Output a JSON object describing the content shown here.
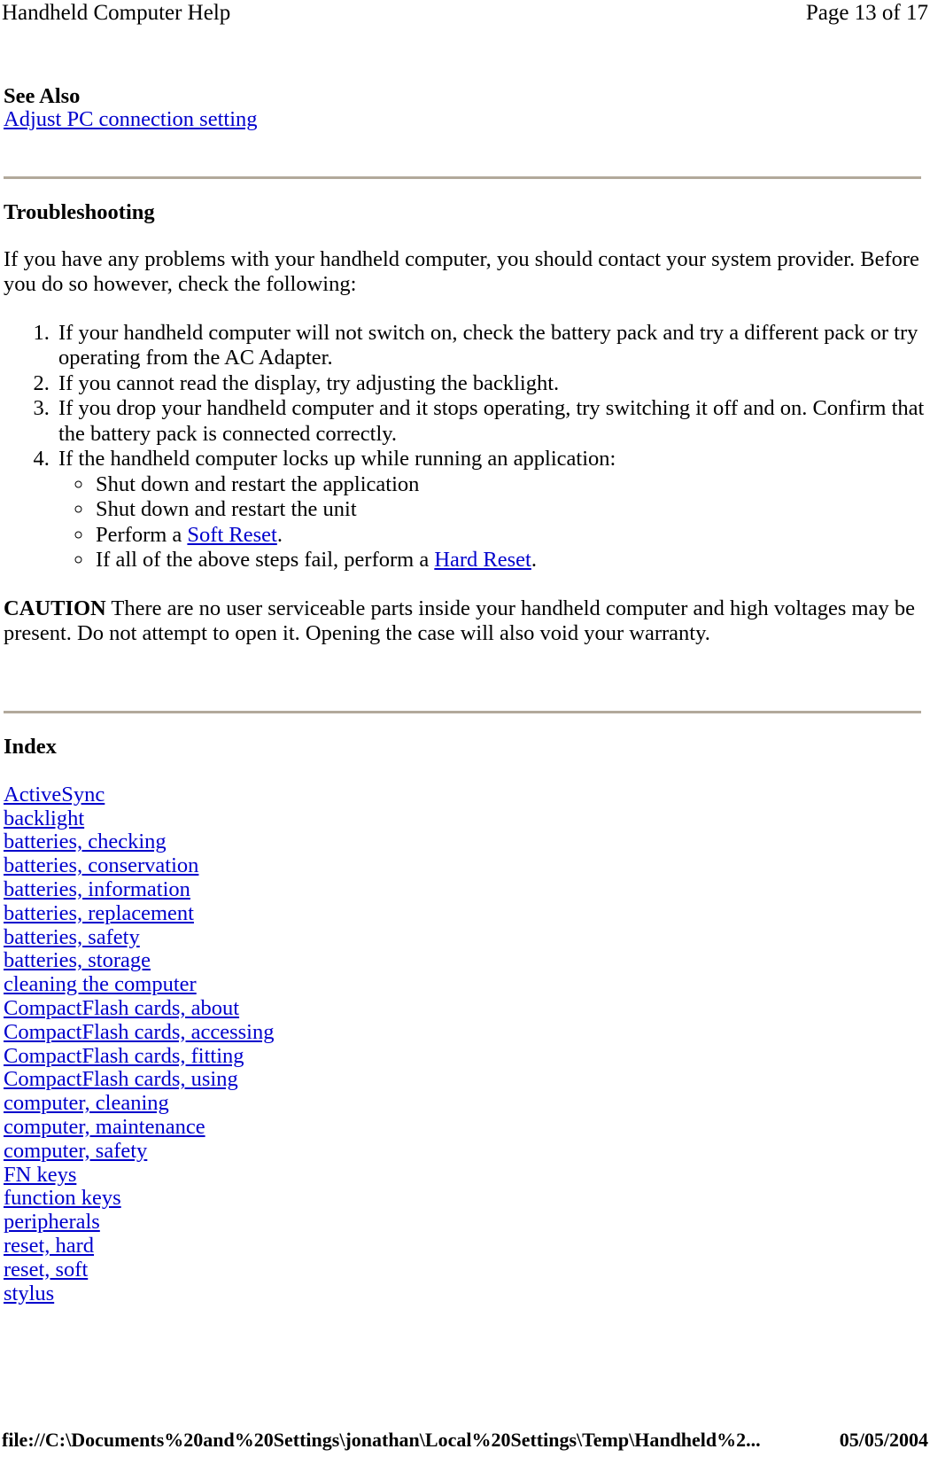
{
  "print_header": {
    "title": "Handheld Computer Help",
    "page_label": "Page 13 of 17"
  },
  "see_also": {
    "heading": "See Also",
    "links": [
      "Adjust PC connection setting"
    ]
  },
  "troubleshooting": {
    "heading": "Troubleshooting",
    "intro": "If you have any problems with your handheld computer, you should contact your system provider. Before you do so however, check the following:",
    "steps": [
      "If your handheld computer will not switch on, check the battery pack and try a different pack or try operating from the AC Adapter.",
      "If you cannot read the display, try adjusting the backlight.",
      "If you drop your handheld computer and it stops operating, try switching it off and on. Confirm that the battery pack is connected correctly.",
      "If the handheld computer locks up while running an application:"
    ],
    "substeps": [
      {
        "text": "Shut down and restart the application",
        "link": "",
        "prefix": "",
        "suffix": ""
      },
      {
        "text": "Shut down and restart the unit",
        "link": "",
        "prefix": "",
        "suffix": ""
      },
      {
        "text": "",
        "prefix": "Perform a ",
        "link": "Soft Reset",
        "suffix": "."
      },
      {
        "text": "",
        "prefix": "If all of the above steps fail, perform a ",
        "link": "Hard Reset",
        "suffix": "."
      }
    ],
    "caution_label": "CAUTION",
    "caution_text": " There are no user serviceable parts inside your handheld computer and high voltages may be present. Do not attempt to open it. Opening the case will also void your warranty."
  },
  "index": {
    "heading": "Index",
    "entries": [
      "ActiveSync",
      "backlight",
      "batteries, checking",
      "batteries, conservation",
      "batteries, information",
      "batteries, replacement",
      "batteries, safety",
      "batteries, storage",
      "cleaning the computer",
      "CompactFlash cards, about",
      "CompactFlash cards, accessing",
      "CompactFlash cards, fitting",
      "CompactFlash cards, using",
      "computer, cleaning",
      "computer, maintenance",
      "computer, safety",
      "FN keys",
      "function keys",
      "peripherals",
      "reset, hard",
      "reset, soft",
      "stylus"
    ]
  },
  "print_footer": {
    "url": "file://C:\\Documents%20and%20Settings\\jonathan\\Local%20Settings\\Temp\\Handheld%2...",
    "date": "05/05/2004"
  },
  "colors": {
    "link": "#0000cc",
    "rule": "#b2a99b",
    "text": "#000000",
    "background": "#ffffff"
  }
}
